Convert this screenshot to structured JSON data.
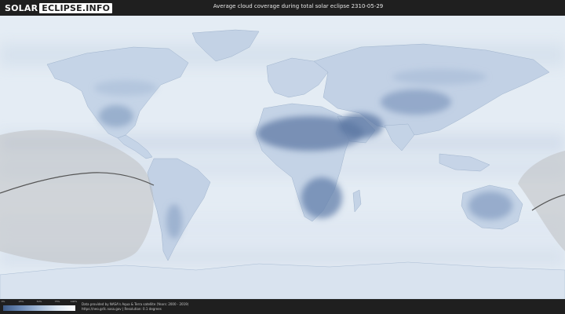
{
  "header": {
    "logo_left": "SOLAR",
    "logo_right": "ECLIPSE.INFO",
    "title": "Average cloud coverage during total solar eclipse 2310-05-29"
  },
  "legend": {
    "ticks": [
      "0%",
      "25%",
      "50%",
      "75%",
      "100%"
    ],
    "colors": [
      "#3d5a86",
      "#6d8bb6",
      "#a5bcd8",
      "#dbe6f1",
      "#ffffff"
    ]
  },
  "footer": {
    "credit_line1": "Data provided by NASA's Aqua & Terra satellite (Years: 2000 - 2019)",
    "credit_line2": "https://neo.gsfc.nasa.gov | Resolution: 0.1 degrees"
  },
  "map": {
    "ocean_color": "#e4ecf4",
    "land_color": "#c9d7e8",
    "clear_sky_color": "#5f7aa6",
    "shadow_color": "#b8b8b8"
  }
}
